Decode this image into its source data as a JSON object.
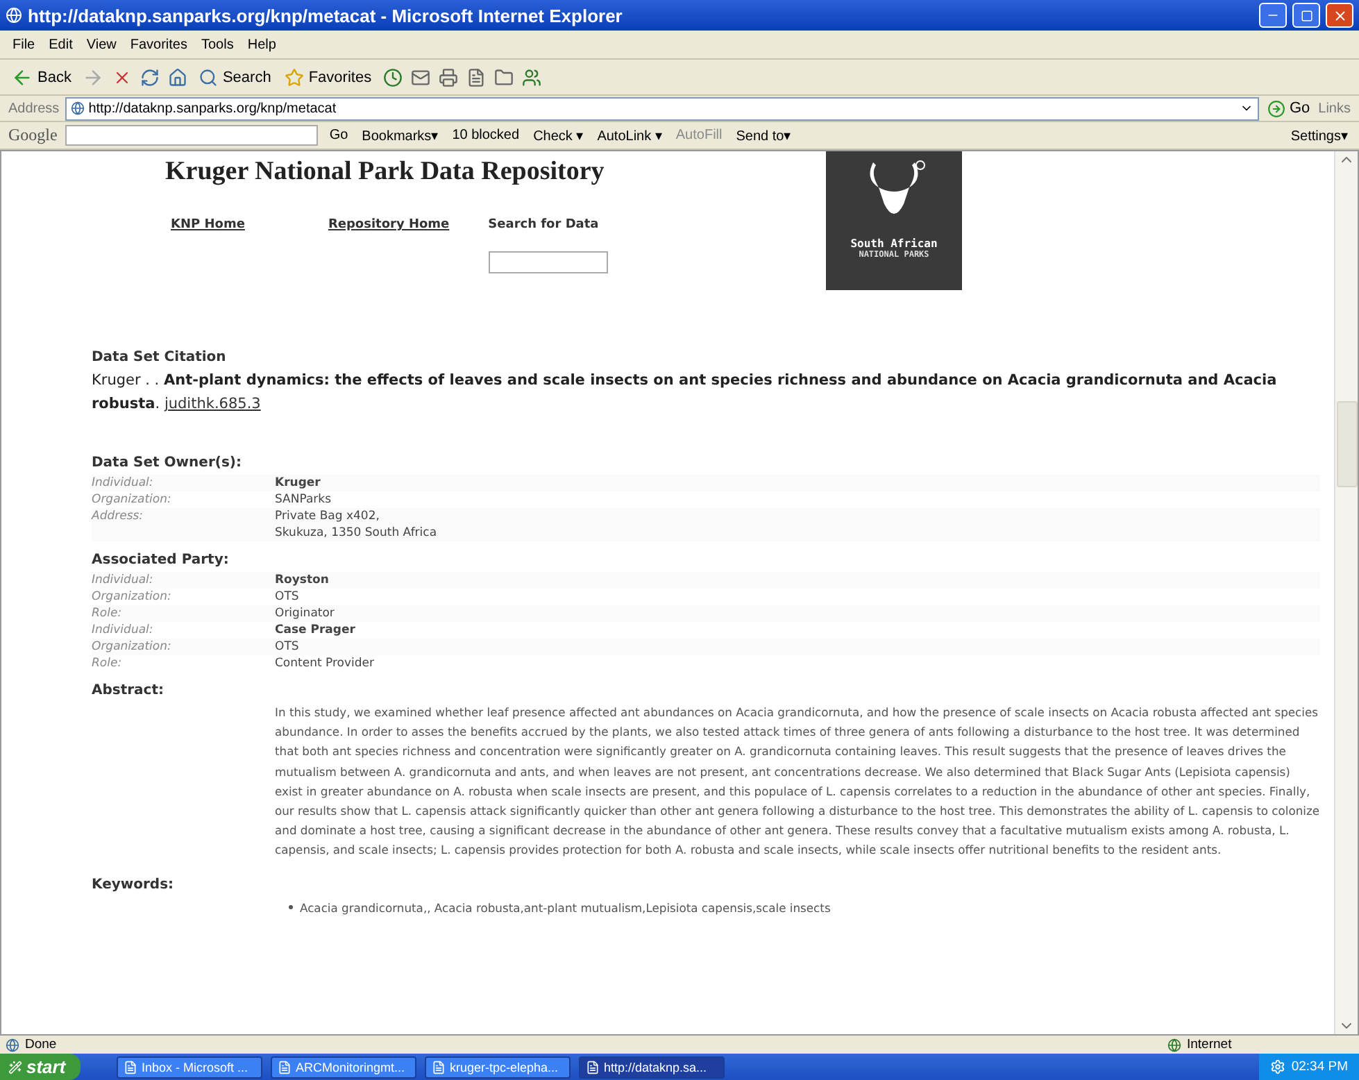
{
  "window": {
    "title": "http://dataknp.sanparks.org/knp/metacat - Microsoft Internet Explorer"
  },
  "menu_bar": [
    "File",
    "Edit",
    "View",
    "Favorites",
    "Tools",
    "Help"
  ],
  "toolbar": {
    "back": "Back",
    "search": "Search",
    "favorites": "Favorites"
  },
  "address_bar": {
    "label": "Address",
    "value": "http://dataknp.sanparks.org/knp/metacat",
    "go": "Go",
    "links": "Links"
  },
  "google_bar": {
    "brand": "Google",
    "items": [
      {
        "label": "Go",
        "disabled": false
      },
      {
        "label": "Bookmarks▾",
        "disabled": false
      },
      {
        "label": "10 blocked",
        "disabled": false
      },
      {
        "label": "Check ▾",
        "disabled": false
      },
      {
        "label": "AutoLink ▾",
        "disabled": false
      },
      {
        "label": "AutoFill",
        "disabled": true
      },
      {
        "label": "Send to▾",
        "disabled": false
      }
    ],
    "settings": "Settings▾"
  },
  "page": {
    "site_title": "Kruger National Park Data Repository",
    "nav": [
      {
        "label": "KNP Home",
        "kind": "link"
      },
      {
        "label": "Repository Home",
        "kind": "link"
      },
      {
        "label": "Search for Data",
        "kind": "label"
      }
    ],
    "logo": {
      "line_1": "South African",
      "line_2": "NATIONAL PARKS"
    },
    "citation": {
      "heading": "Data Set Citation",
      "text": "Kruger . . **Ant-plant dynamics: the effects of leaves and scale insects on ant species richness and abundance on Acacia grandicornuta and Acacia robusta**. ",
      "link": "judithk.685.3"
    },
    "sections": [
      {
        "heading": "Data Set Owner(s):",
        "rows": [
          {
            "label": "Individual:",
            "lines": [
              "Kruger"
            ],
            "bold": true
          },
          {
            "label": "Organization:",
            "lines": [
              "SANParks"
            ],
            "bold": false
          },
          {
            "label": "Address:",
            "lines": [
              "Private Bag x402,",
              "Skukuza, 1350 South Africa"
            ],
            "bold": false
          }
        ]
      },
      {
        "heading": "Associated Party:",
        "rows": [
          {
            "label": "Individual:",
            "lines": [
              "Royston"
            ],
            "bold": true
          },
          {
            "label": "Organization:",
            "lines": [
              "OTS"
            ],
            "bold": false
          },
          {
            "label": "Role:",
            "lines": [
              "Originator"
            ],
            "bold": false
          },
          {
            "label": "Individual:",
            "lines": [
              "Case Prager"
            ],
            "bold": true
          },
          {
            "label": "Organization:",
            "lines": [
              "OTS"
            ],
            "bold": false
          },
          {
            "label": "Role:",
            "lines": [
              "Content Provider"
            ],
            "bold": false
          }
        ]
      }
    ],
    "abstract": {
      "heading": "Abstract:",
      "text": "In this study, we examined whether leaf presence affected ant abundances on Acacia grandicornuta, and how the presence of scale insects on Acacia robusta affected ant species abundance. In order to asses the benefits accrued by the plants, we also tested attack times of three genera of ants following a disturbance to the host tree. It was determined that both ant species richness and concentration were significantly greater on A. grandicornuta containing leaves. This result suggests that the presence of leaves drives the mutualism between A. grandicornuta and ants, and when leaves are not present, ant concentrations decrease. We also determined that Black Sugar Ants (Lepisiota capensis) exist in greater abundance on A. robusta when scale insects are present, and this populace of L. capensis correlates to a reduction in the abundance of other ant species. Finally, our results show that L. capensis attack significantly quicker than other ant genera following a disturbance to the host tree. This demonstrates the ability of L. capensis to colonize and dominate a host tree, causing a significant decrease in the abundance of other ant genera. These results convey that a facultative mutualism exists among A. robusta, L. capensis, and scale insects; L. capensis provides protection for both A. robusta and scale insects, while scale insects offer nutritional benefits to the resident ants."
    },
    "keywords": {
      "heading": "Keywords:",
      "items": [
        "Acacia grandicornuta,, Acacia robusta,ant-plant mutualism,Lepisiota capensis,scale insects"
      ]
    }
  },
  "status_bar": {
    "status": "Done",
    "zone": "Internet"
  },
  "taskbar": {
    "start": "start",
    "tasks": [
      {
        "label": "Inbox - Microsoft ...",
        "selected": false
      },
      {
        "label": "ARCMonitoringmt...",
        "selected": false
      },
      {
        "label": "kruger-tpc-elepha...",
        "selected": false
      },
      {
        "label": "http://dataknp.sa...",
        "selected": true
      }
    ],
    "clock": "02:34 PM"
  }
}
